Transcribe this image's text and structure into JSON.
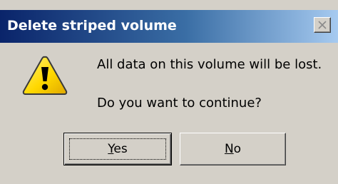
{
  "window": {
    "title": "Delete striped volume"
  },
  "message": {
    "line1": "All data on this volume will be lost.",
    "line2": "Do you want to continue?"
  },
  "icons": {
    "warning": "warning-triangle-icon",
    "close": "close-x-icon"
  },
  "buttons": {
    "yes": {
      "mnemonic": "Y",
      "rest": "es"
    },
    "no": {
      "mnemonic": "N",
      "rest": "o"
    }
  },
  "colors": {
    "title_bar_start": "#0a246a",
    "title_bar_end": "#a6caf0",
    "dialog_face": "#d4d0c8",
    "warning_yellow": "#ffd800"
  }
}
